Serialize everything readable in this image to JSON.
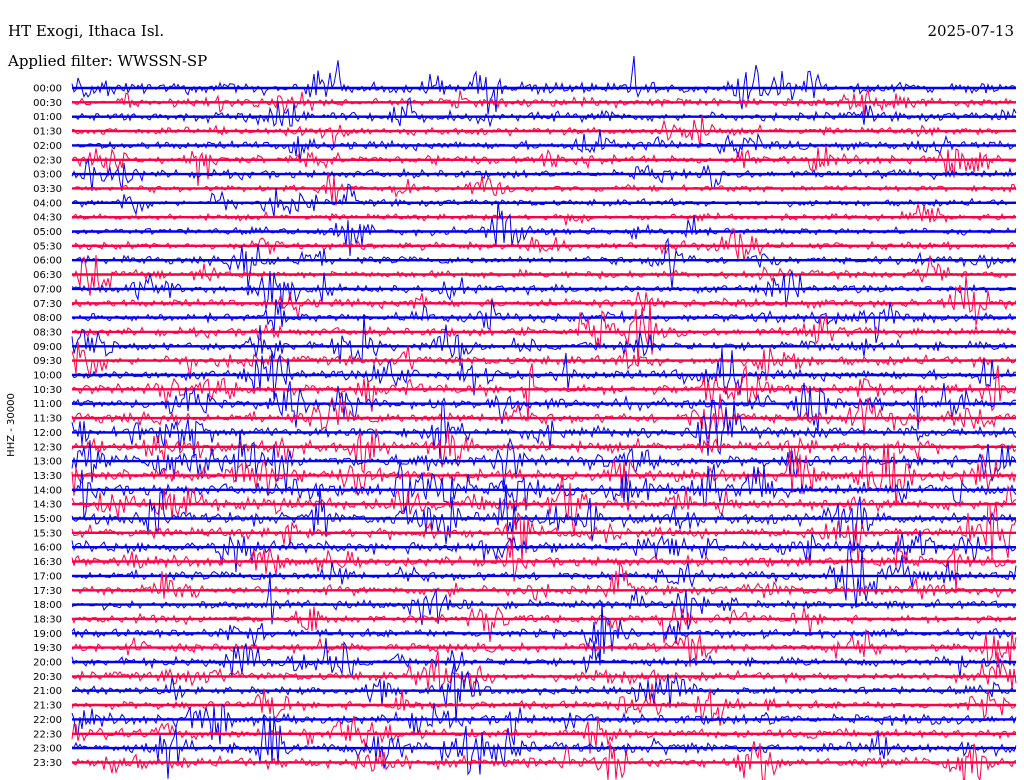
{
  "header": {
    "station": "HT Exogi, Ithaca Isl.",
    "date": "2025-07-13",
    "filter_label": "Applied filter: WWSSN-SP"
  },
  "chart_data": {
    "type": "line",
    "title": "HT Exogi, Ithaca Isl.",
    "subtitle": "Applied filter: WWSSN-SP",
    "date": "2025-07-13",
    "ylabel": "HHZ - 30000",
    "xlabel": "",
    "trace_colors": [
      "#0000ee",
      "#ff0044"
    ],
    "rows": [
      {
        "label": "00:00",
        "activity": 0.9
      },
      {
        "label": "00:30",
        "activity": 0.5
      },
      {
        "label": "01:00",
        "activity": 0.6
      },
      {
        "label": "01:30",
        "activity": 0.4
      },
      {
        "label": "02:00",
        "activity": 0.5
      },
      {
        "label": "02:30",
        "activity": 0.6
      },
      {
        "label": "03:00",
        "activity": 0.5
      },
      {
        "label": "03:30",
        "activity": 0.25
      },
      {
        "label": "04:00",
        "activity": 0.3
      },
      {
        "label": "04:30",
        "activity": 0.25
      },
      {
        "label": "05:00",
        "activity": 0.35
      },
      {
        "label": "05:30",
        "activity": 0.35
      },
      {
        "label": "06:00",
        "activity": 0.45
      },
      {
        "label": "06:30",
        "activity": 0.4
      },
      {
        "label": "07:00",
        "activity": 0.45
      },
      {
        "label": "07:30",
        "activity": 0.5
      },
      {
        "label": "08:00",
        "activity": 0.55
      },
      {
        "label": "08:30",
        "activity": 0.55
      },
      {
        "label": "09:00",
        "activity": 0.6
      },
      {
        "label": "09:30",
        "activity": 0.6
      },
      {
        "label": "10:00",
        "activity": 0.7
      },
      {
        "label": "10:30",
        "activity": 0.8
      },
      {
        "label": "11:00",
        "activity": 0.8
      },
      {
        "label": "11:30",
        "activity": 0.85
      },
      {
        "label": "12:00",
        "activity": 0.85
      },
      {
        "label": "12:30",
        "activity": 0.9
      },
      {
        "label": "13:00",
        "activity": 1.0
      },
      {
        "label": "13:30",
        "activity": 1.0
      },
      {
        "label": "14:00",
        "activity": 1.0
      },
      {
        "label": "14:30",
        "activity": 1.0
      },
      {
        "label": "15:00",
        "activity": 0.95
      },
      {
        "label": "15:30",
        "activity": 0.85
      },
      {
        "label": "16:00",
        "activity": 0.85
      },
      {
        "label": "16:30",
        "activity": 0.75
      },
      {
        "label": "17:00",
        "activity": 0.7
      },
      {
        "label": "17:30",
        "activity": 0.6
      },
      {
        "label": "18:00",
        "activity": 0.5
      },
      {
        "label": "18:30",
        "activity": 0.5
      },
      {
        "label": "19:00",
        "activity": 0.55
      },
      {
        "label": "19:30",
        "activity": 0.6
      },
      {
        "label": "20:00",
        "activity": 0.6
      },
      {
        "label": "20:30",
        "activity": 0.6
      },
      {
        "label": "21:00",
        "activity": 0.5
      },
      {
        "label": "21:30",
        "activity": 0.5
      },
      {
        "label": "22:00",
        "activity": 0.7
      },
      {
        "label": "22:30",
        "activity": 0.6
      },
      {
        "label": "23:00",
        "activity": 0.8
      },
      {
        "label": "23:30",
        "activity": 0.8
      }
    ]
  }
}
